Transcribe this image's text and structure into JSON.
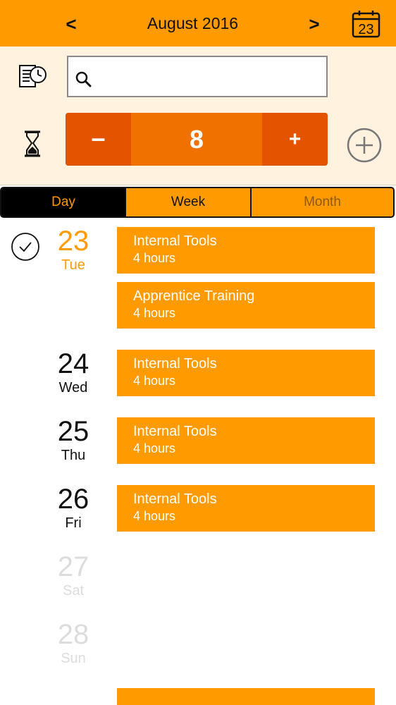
{
  "header": {
    "prev_label": "<",
    "title": "August 2016",
    "next_label": ">",
    "calendar_icon_day": "23"
  },
  "toolbar": {
    "search": {
      "value": "",
      "placeholder": ""
    },
    "stepper": {
      "minus_label": "–",
      "value": "8",
      "plus_label": "+"
    }
  },
  "segments": {
    "day": "Day",
    "week": "Week",
    "month": "Month",
    "selected": "Day"
  },
  "days": [
    {
      "num": "23",
      "name": "Tue",
      "state": "today",
      "checked": true
    },
    {
      "num": "24",
      "name": "Wed",
      "state": "normal"
    },
    {
      "num": "25",
      "name": "Thu",
      "state": "normal"
    },
    {
      "num": "26",
      "name": "Fri",
      "state": "normal"
    },
    {
      "num": "27",
      "name": "Sat",
      "state": "weekend"
    },
    {
      "num": "28",
      "name": "Sun",
      "state": "weekend"
    }
  ],
  "entries": [
    {
      "title": "Internal Tools",
      "hours": "4 hours"
    },
    {
      "title": "Apprentice Training",
      "hours": "4 hours"
    },
    {
      "title": "Internal Tools",
      "hours": "4 hours"
    },
    {
      "title": "Internal Tools",
      "hours": "4 hours"
    },
    {
      "title": "Internal Tools",
      "hours": "4 hours"
    }
  ],
  "colors": {
    "accent": "#FF9A00",
    "stepper_dark": "#E45400",
    "stepper_mid": "#F07000",
    "toolbar_bg": "#FFF2DF"
  },
  "icons": [
    "calendar-icon",
    "history-icon",
    "search-icon",
    "hourglass-icon",
    "add-circle-icon",
    "check-circle-icon"
  ]
}
